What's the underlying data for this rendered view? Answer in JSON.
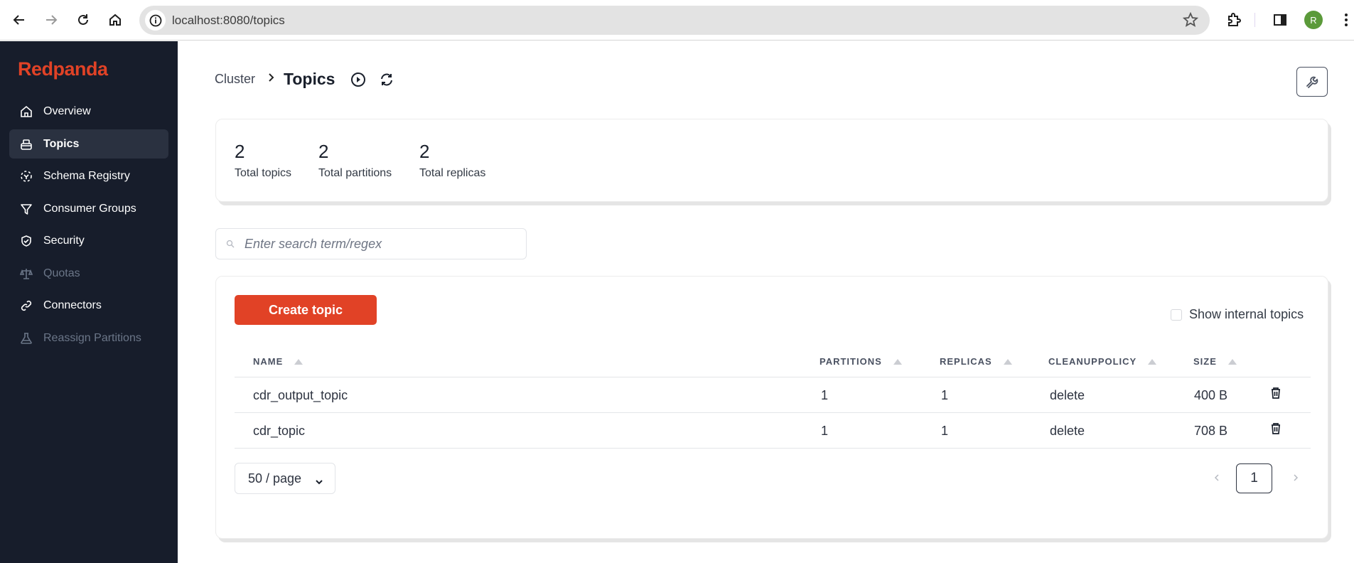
{
  "browser": {
    "url": "localhost:8080/topics",
    "profile_initial": "R",
    "profile_color": "#5b9a3a"
  },
  "sidebar": {
    "logo": "Redpanda",
    "brand_color": "#e14226",
    "items": [
      {
        "label": "Overview",
        "icon": "home-icon",
        "state": "normal"
      },
      {
        "label": "Topics",
        "icon": "topics-icon",
        "state": "active"
      },
      {
        "label": "Schema Registry",
        "icon": "schema-icon",
        "state": "normal"
      },
      {
        "label": "Consumer Groups",
        "icon": "funnel-icon",
        "state": "normal"
      },
      {
        "label": "Security",
        "icon": "shield-check-icon",
        "state": "normal"
      },
      {
        "label": "Quotas",
        "icon": "scale-icon",
        "state": "disabled"
      },
      {
        "label": "Connectors",
        "icon": "link-icon",
        "state": "normal"
      },
      {
        "label": "Reassign Partitions",
        "icon": "beaker-icon",
        "state": "disabled"
      }
    ]
  },
  "header": {
    "breadcrumb_parent": "Cluster",
    "title": "Topics"
  },
  "stats": [
    {
      "value": "2",
      "label": "Total topics"
    },
    {
      "value": "2",
      "label": "Total partitions"
    },
    {
      "value": "2",
      "label": "Total replicas"
    }
  ],
  "search": {
    "placeholder": "Enter search term/regex",
    "value": ""
  },
  "toolbar": {
    "create_label": "Create topic",
    "show_internal_label": "Show internal topics",
    "show_internal_checked": false
  },
  "table": {
    "columns": [
      "NAME",
      "PARTITIONS",
      "REPLICAS",
      "CLEANUPPOLICY",
      "SIZE"
    ],
    "rows": [
      {
        "name": "cdr_output_topic",
        "partitions": "1",
        "replicas": "1",
        "cleanup": "delete",
        "size": "400 B"
      },
      {
        "name": "cdr_topic",
        "partitions": "1",
        "replicas": "1",
        "cleanup": "delete",
        "size": "708 B"
      }
    ]
  },
  "pagination": {
    "page_size_label": "50 / page",
    "current_page": "1"
  }
}
